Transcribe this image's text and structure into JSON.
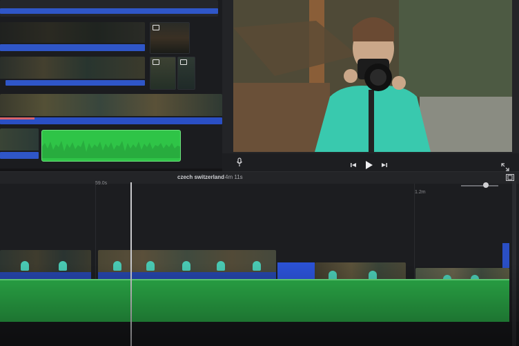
{
  "project": {
    "title": "czech switzerland",
    "duration": "4m 11s"
  },
  "timeline": {
    "ticks": [
      "59.0s",
      "1.2m"
    ]
  },
  "viewer": {
    "controls": {
      "mic_icon": "microphone-icon",
      "prev_icon": "skip-back-icon",
      "play_icon": "play-icon",
      "next_icon": "skip-forward-icon",
      "fullscreen_icon": "expand-icon",
      "filmstrip_icon": "filmstrip-icon"
    }
  },
  "colors": {
    "clip_blue": "#2f56c8",
    "audio_green": "#2fc447",
    "music_green": "#2bab48",
    "background": "#1c1d20"
  }
}
